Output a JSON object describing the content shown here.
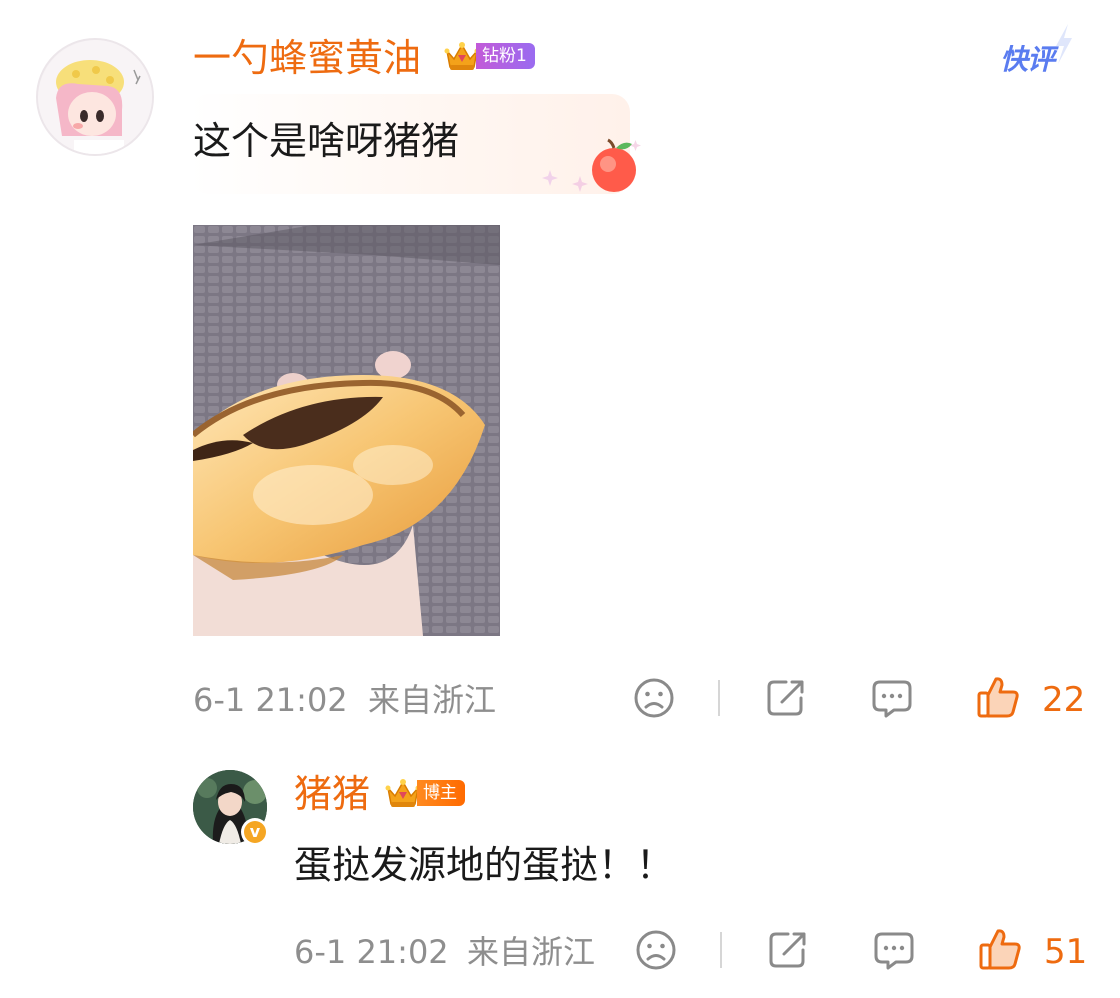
{
  "comment": {
    "username": "一勺蜂蜜黄油",
    "badge": {
      "level": "6",
      "label": "钻粉1"
    },
    "text": "这个是啥呀猪猪",
    "timestamp": "6-1 21:02",
    "location": "来自浙江",
    "like_count": "22",
    "quick_review": "快评"
  },
  "reply": {
    "username": "猪猪",
    "badge": {
      "level": "7",
      "label": "博主"
    },
    "verified_mark": "v",
    "text": "蛋挞发源地的蛋挞！！",
    "timestamp": "6-1 21:02",
    "location": "来自浙江",
    "like_count": "51"
  },
  "colors": {
    "accent": "#ee6b10",
    "meta_gray": "#8e8e8e",
    "quick_review_blue": "#5a7cf0"
  },
  "icons": [
    "frown-icon",
    "share-icon",
    "comment-icon",
    "thumb-up-icon",
    "crown-icon",
    "apple-sticker-icon"
  ]
}
